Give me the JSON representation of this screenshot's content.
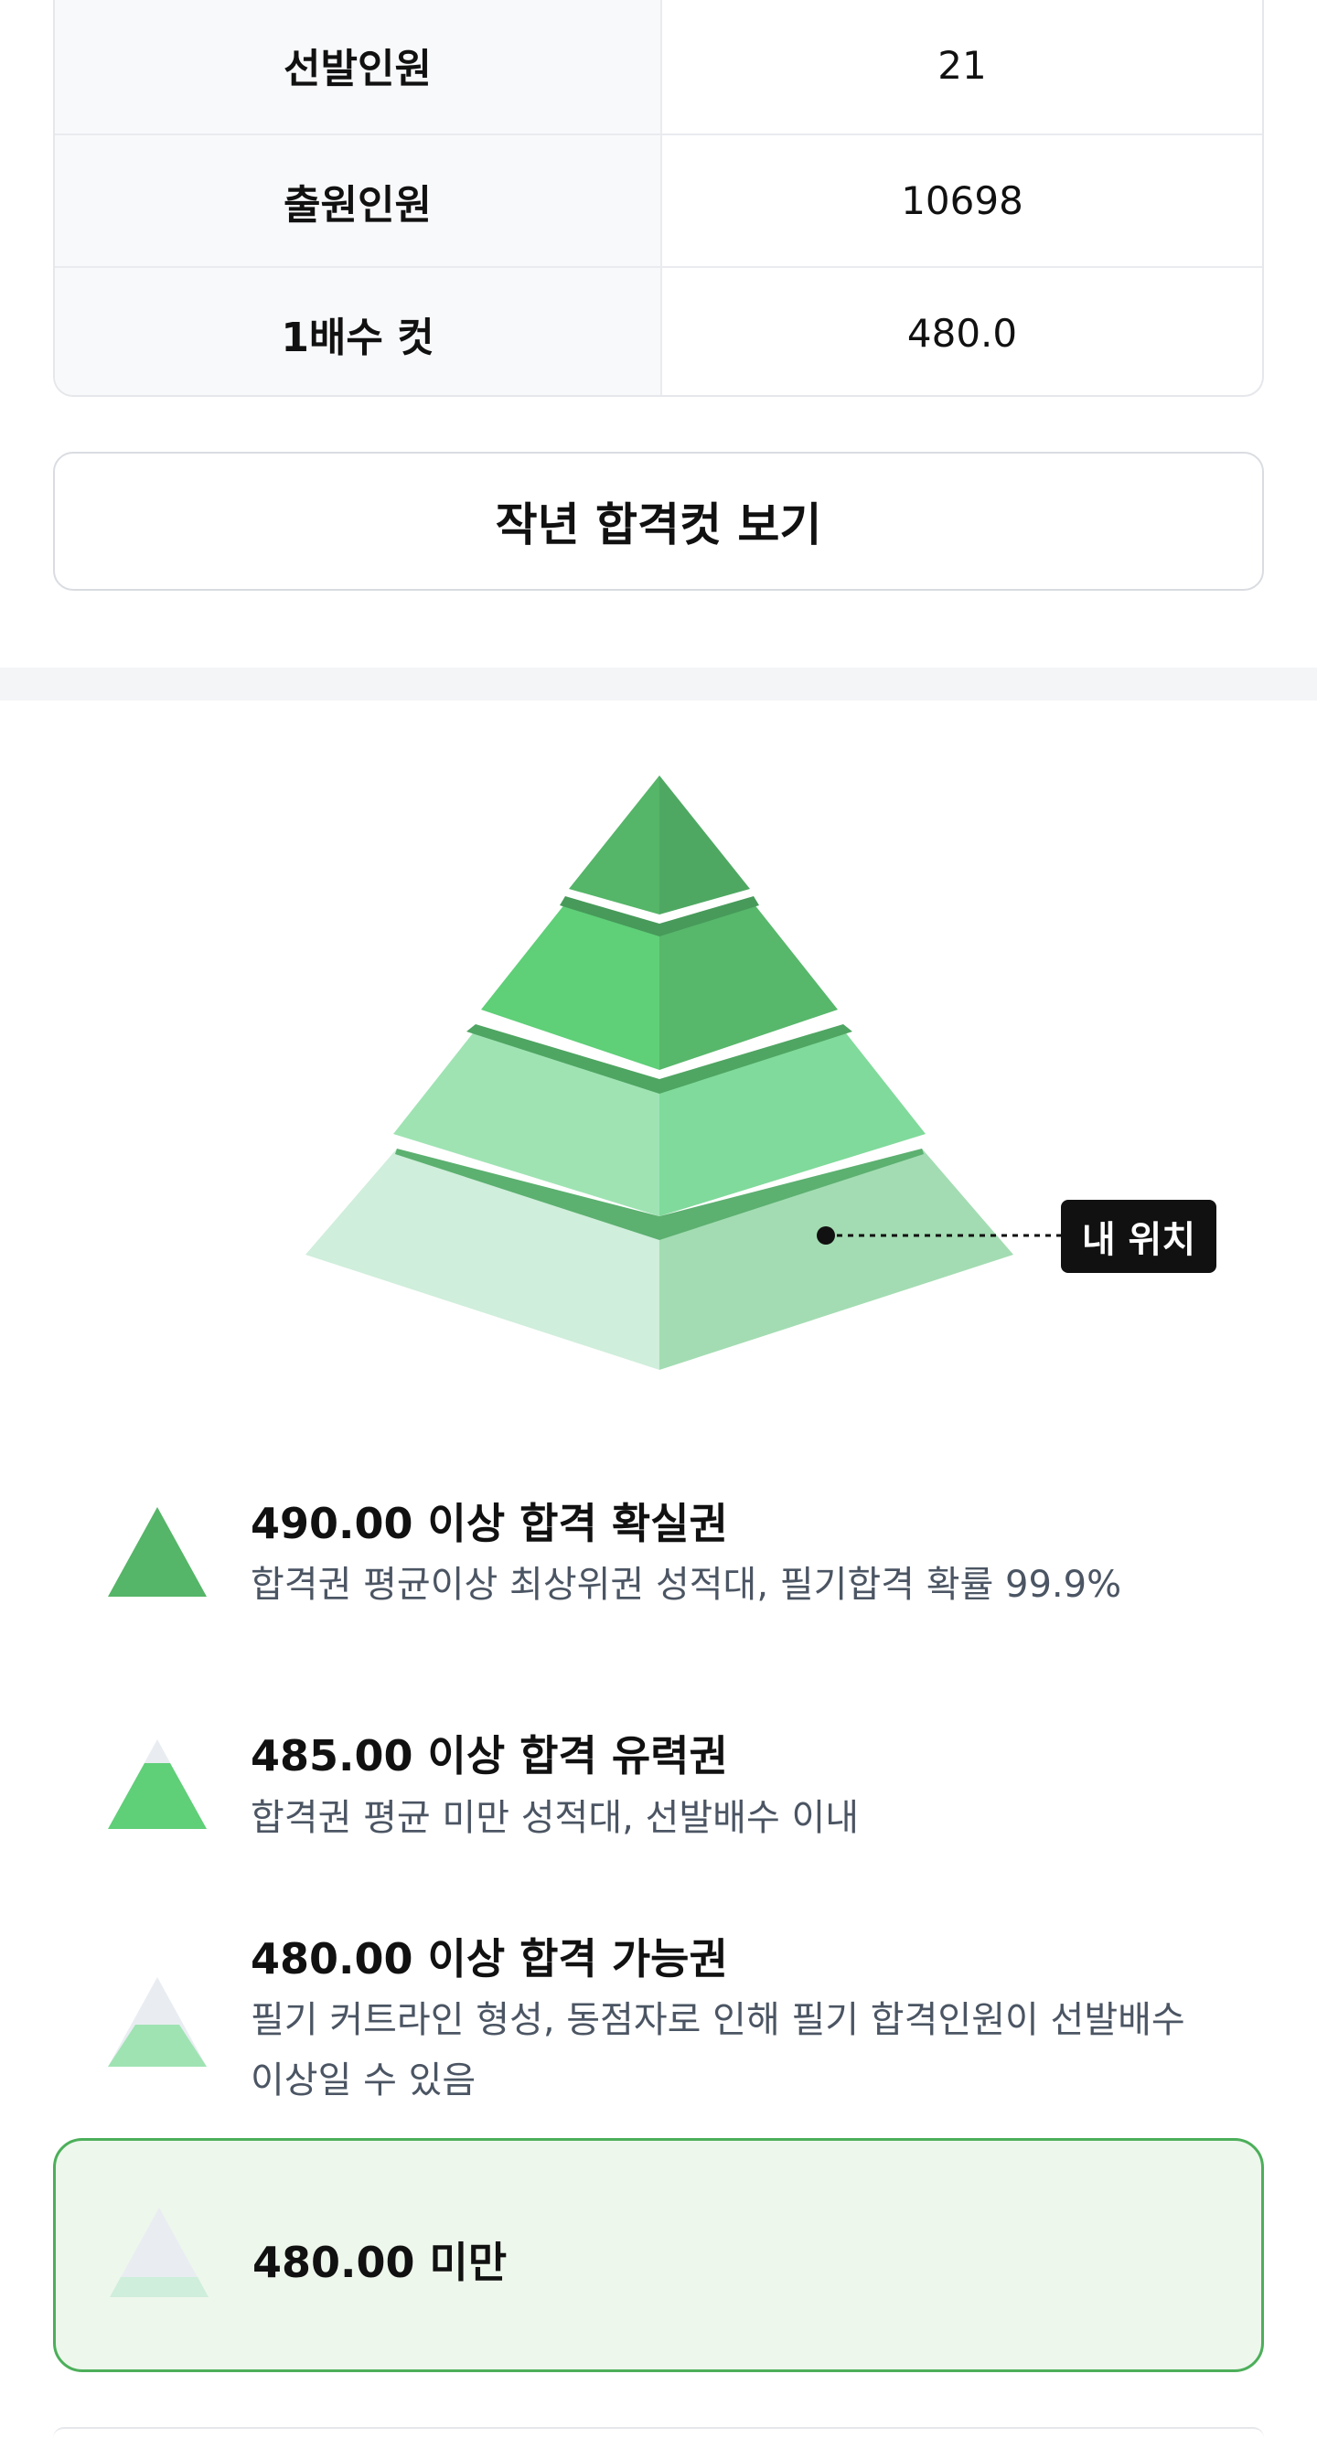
{
  "info_table": {
    "rows": [
      {
        "key": "선발인원",
        "value": "21"
      },
      {
        "key": "출원인원",
        "value": "10698"
      },
      {
        "key": "1배수 컷",
        "value": "480.0"
      }
    ]
  },
  "prev_cut_button": {
    "label": "작년 합격컷 보기"
  },
  "pyramid": {
    "my_position_label": "내 위치",
    "colors": {
      "tier1": "#55b568",
      "tier2": "#5fcf78",
      "tier3": "#9fe3b3",
      "tier4": "#cfeedb",
      "empty": "#e9edf2"
    }
  },
  "legend": {
    "items": [
      {
        "title": "490.00 이상 합격 확실권",
        "desc": "합격권 평균이상 최상위권 성적대, 필기합격 확률 99.9%"
      },
      {
        "title": "485.00 이상 합격 유력권",
        "desc": "합격권 평균 미만 성적대, 선발배수 이내"
      },
      {
        "title": "480.00 이상 합격 가능권",
        "desc": "필기 커트라인 형성, 동점자로 인해 필기 합격인원이 선발배수 이상일 수 있음"
      }
    ],
    "current": {
      "title": "480.00 미만"
    }
  }
}
